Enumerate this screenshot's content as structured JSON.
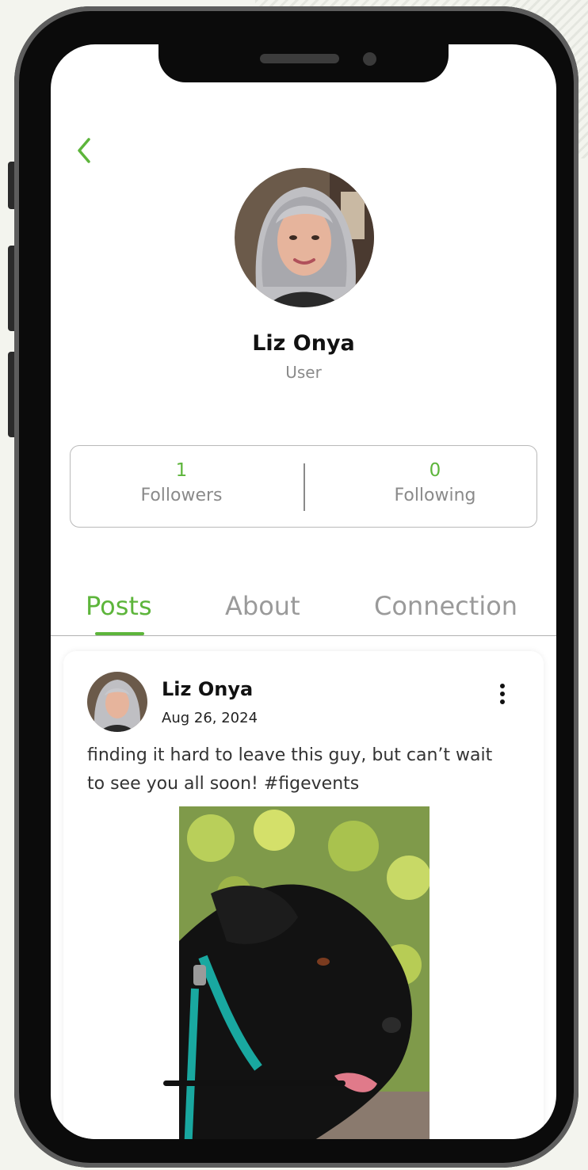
{
  "profile": {
    "name": "Liz Onya",
    "role": "User"
  },
  "stats": {
    "followers_value": "1",
    "followers_label": "Followers",
    "following_value": "0",
    "following_label": "Following"
  },
  "tabs": [
    {
      "label": "Posts",
      "active": true
    },
    {
      "label": "About",
      "active": false
    },
    {
      "label": "Connection",
      "active": false
    }
  ],
  "post": {
    "author": "Liz Onya",
    "date": "Aug 26, 2024",
    "text": "finding it hard to leave this guy, but can’t wait to see you all soon! #figevents"
  },
  "icons": {
    "back": "chevron-left-icon",
    "more": "vertical-ellipsis-icon"
  },
  "colors": {
    "accent": "#5db53b",
    "muted": "#8a8a8a"
  }
}
